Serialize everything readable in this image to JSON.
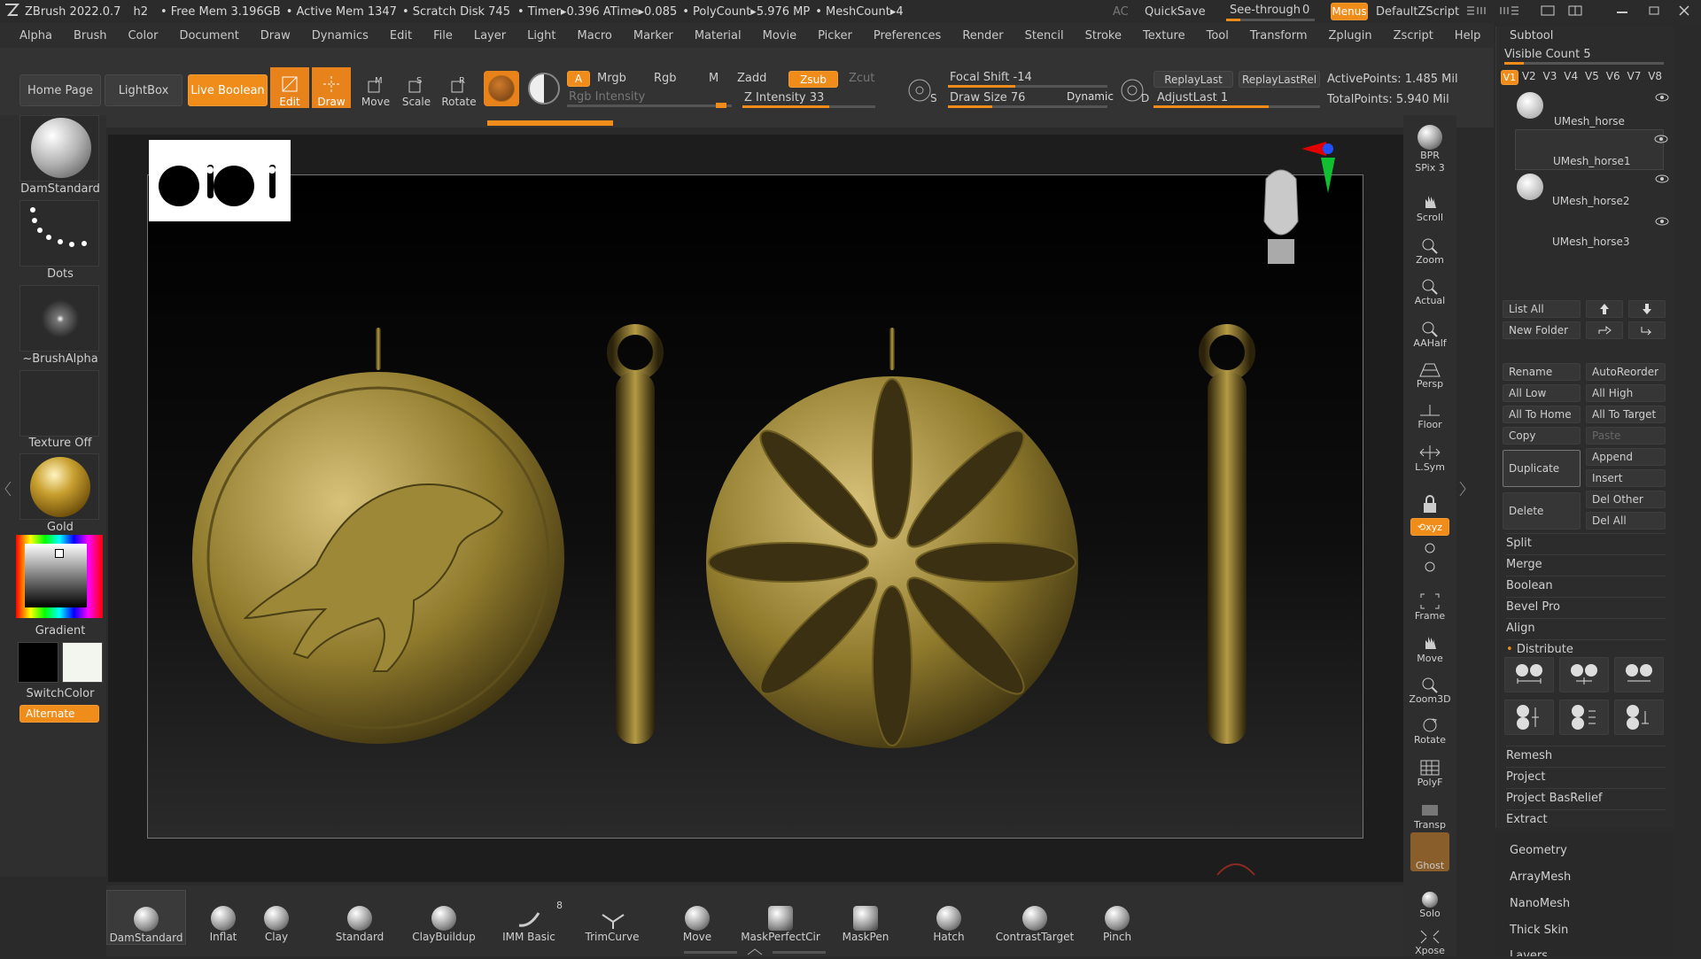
{
  "titlebar": {
    "app": "ZBrush 2022.0.7",
    "doc": "h2",
    "free_mem": "• Free Mem 3.196GB",
    "active_mem": "• Active Mem 1347",
    "scratch": "• Scratch Disk 745",
    "timer": "• Timer▸0.396 ATime▸0.085",
    "polycount": "• PolyCount▸5.976 MP",
    "meshcount": "• MeshCount▸4",
    "ac": "AC",
    "quicksave": "QuickSave",
    "seethrough": "See-through",
    "seethrough_value": "0",
    "menus": "Menus",
    "defaultscript": "DefaultZScript"
  },
  "menubar": [
    "Alpha",
    "Brush",
    "Color",
    "Document",
    "Draw",
    "Dynamics",
    "Edit",
    "File",
    "Layer",
    "Light",
    "Macro",
    "Marker",
    "Material",
    "Movie",
    "Picker",
    "Preferences",
    "Render",
    "Stencil",
    "Stroke",
    "Texture",
    "Tool",
    "Transform",
    "Zplugin",
    "Zscript",
    "Help"
  ],
  "toolbar": {
    "home": "Home Page",
    "lightbox": "LightBox",
    "liveboolean": "Live Boolean",
    "edit": "Edit",
    "draw": "Draw",
    "move": "Move",
    "scale": "Scale",
    "rotate": "Rotate",
    "a": "A",
    "mrgb": "Mrgb",
    "rgb": "Rgb",
    "m": "M",
    "zadd": "Zadd",
    "zsub": "Zsub",
    "zcut": "Zcut",
    "rgb_intensity": "Rgb Intensity",
    "z_intensity": "Z Intensity 33",
    "focal_shift": "Focal Shift -14",
    "draw_size": "Draw Size 76",
    "dynamic": "Dynamic",
    "replaylast": "ReplayLast",
    "replaylastrel": "ReplayLastRel",
    "adjustlast": "AdjustLast 1",
    "active_points": "ActivePoints: 1.485 Mil",
    "total_points": "TotalPoints: 5.940 Mil",
    "s": "S",
    "d": "D"
  },
  "leftshelf": {
    "brush": "DamStandard",
    "stroke": "Dots",
    "alpha": "~BrushAlpha",
    "texture": "Texture Off",
    "material": "Gold",
    "gradient": "Gradient",
    "switchcolor": "SwitchColor",
    "alternate": "Alternate"
  },
  "rightbar": [
    "BPR",
    "SPix 3",
    "Scroll",
    "Zoom",
    "Actual",
    "AAHalf",
    "Persp",
    "Floor",
    "L.Sym",
    "",
    "Frame",
    "Move",
    "Zoom3D",
    "Rotate",
    "PolyF",
    "Transp",
    "Ghost",
    "Solo",
    "Xpose"
  ],
  "subtool": {
    "title": "Subtool",
    "visible_count": "Visible Count 5",
    "versions": [
      "V1",
      "V2",
      "V3",
      "V4",
      "V5",
      "V6",
      "V7",
      "V8"
    ],
    "items": [
      "UMesh_horse",
      "UMesh_horse1",
      "UMesh_horse2",
      "UMesh_horse3"
    ],
    "listall": "List All",
    "newfolder": "New Folder",
    "rename": "Rename",
    "autoreorder": "AutoReorder",
    "alllow": "All Low",
    "allhigh": "All High",
    "alltohome": "All To Home",
    "alltotarget": "All To Target",
    "copy": "Copy",
    "paste": "Paste",
    "duplicate": "Duplicate",
    "append": "Append",
    "insert": "Insert",
    "delete": "Delete",
    "delother": "Del Other",
    "delall": "Del All",
    "sections": [
      "Split",
      "Merge",
      "Boolean",
      "Bevel Pro",
      "Align",
      "Distribute"
    ],
    "sections2": [
      "Remesh",
      "Project",
      "Project BasRelief",
      "Extract"
    ],
    "more": [
      "Geometry",
      "ArrayMesh",
      "NanoMesh",
      "Thick Skin",
      "Layers"
    ]
  },
  "bottomshelf": {
    "brushes": [
      "DamStandard",
      "Inflat",
      "Clay",
      "Standard",
      "ClayBuildup",
      "IMM Basic",
      "TrimCurve",
      "Move",
      "MaskPerfectCir",
      "MaskPen",
      "Hatch",
      "ContrastTarget",
      "Pinch"
    ],
    "imm_count": "8"
  },
  "colors": {
    "accent": "#f08c1a",
    "gold": "#b59a3c",
    "panel": "#2c2c2c"
  }
}
